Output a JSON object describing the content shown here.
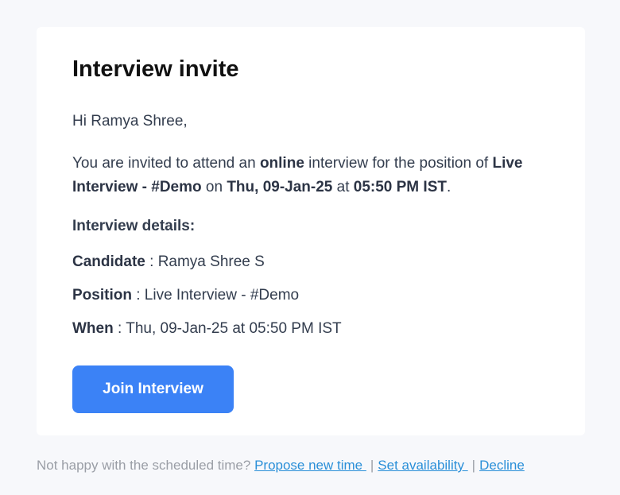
{
  "card": {
    "title": "Interview invite",
    "greeting": "Hi Ramya Shree,",
    "invite": {
      "pre": "You are invited to attend an ",
      "mode": "online",
      "mid": " interview for the position of ",
      "position": "Live Interview - #Demo",
      "on": " on ",
      "date": "Thu, 09-Jan-25",
      "at": " at ",
      "time": "05:50 PM IST",
      "end": "."
    },
    "details_heading": "Interview details:",
    "details": [
      {
        "label": "Candidate",
        "value": " : Ramya Shree S"
      },
      {
        "label": "Position",
        "value": " : Live Interview - #Demo"
      },
      {
        "label": "When",
        "value": " : Thu, 09-Jan-25 at 05:50 PM IST"
      }
    ],
    "join_button": "Join Interview"
  },
  "footer": {
    "prompt": "Not happy with the scheduled time? ",
    "propose_link": "Propose new time ",
    "sep1": "|",
    "availability_link": "Set availability ",
    "sep2": "|",
    "decline_link": "Decline"
  },
  "colors": {
    "background": "#f7f8fb",
    "card": "#ffffff",
    "button": "#3b82f6",
    "link": "#2a8fd8"
  }
}
